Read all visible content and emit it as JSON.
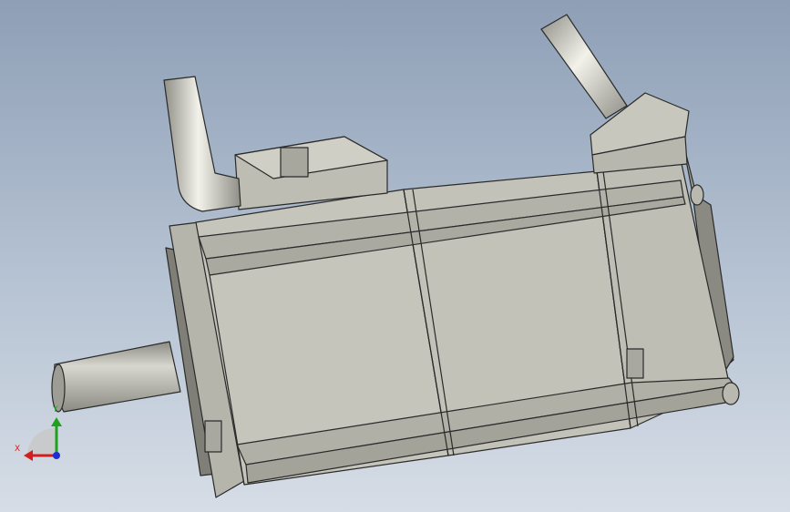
{
  "viewport": {
    "background_top": "#8e9fb6",
    "background_bottom": "#d6dde6"
  },
  "model": {
    "body_color": "#c3c3b9",
    "body_dark": "#a5a59b",
    "edge_color": "#2a2a2a",
    "shaft_color": "#b9b9b0"
  },
  "triad": {
    "x_label": "X",
    "y_label": "Y",
    "x_color": "#d41e1e",
    "y_color": "#1ea21e",
    "z_color": "#1c2fd6"
  }
}
